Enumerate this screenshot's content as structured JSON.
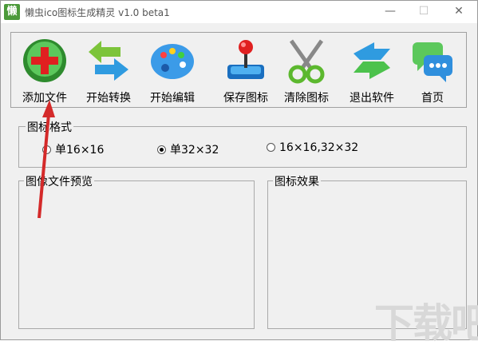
{
  "window": {
    "title": "懒虫ico图标生成精灵 v1.0 beta1",
    "app_icon_char": "懒"
  },
  "titlebar": {
    "minimize": "—",
    "maximize": "☐",
    "close": "✕"
  },
  "toolbar": {
    "add_file": "添加文件",
    "start_convert": "开始转换",
    "start_edit": "开始编辑",
    "save_icon": "保存图标",
    "clear_icon": "清除图标",
    "exit": "退出软件",
    "home": "首页"
  },
  "format_group": {
    "title": "图标格式",
    "options": [
      "单16×16",
      "单32×32",
      "16×16,32×32"
    ],
    "selected": "单32×32"
  },
  "preview_group": {
    "title": "图像文件预览"
  },
  "effect_group": {
    "title": "图标效果"
  },
  "watermark": "下载吧"
}
